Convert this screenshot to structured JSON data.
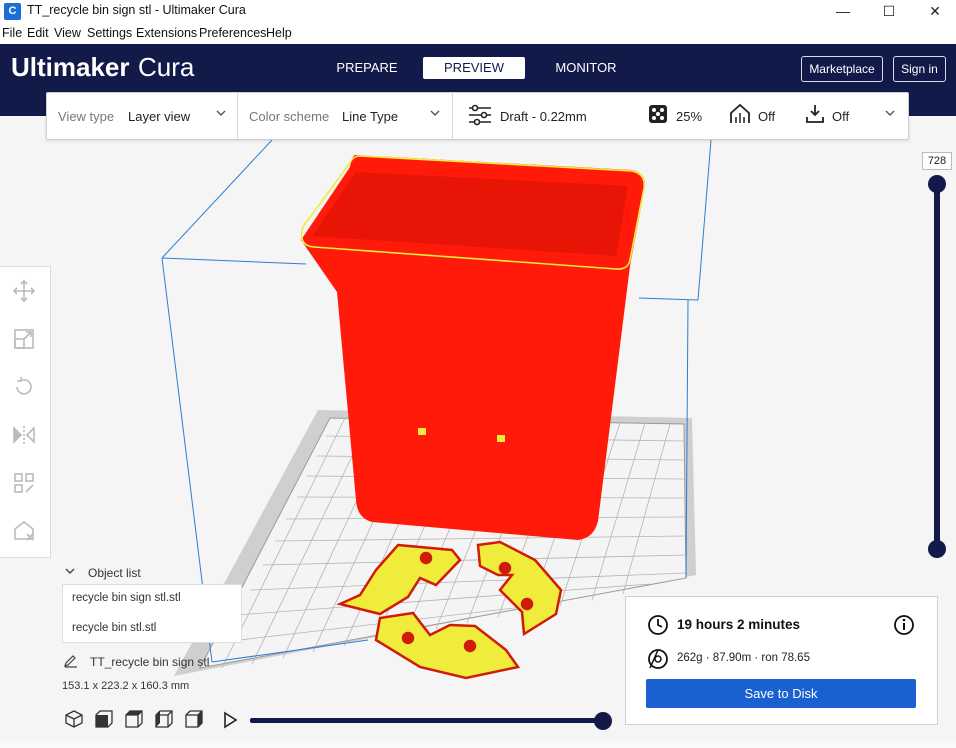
{
  "window": {
    "title": "TT_recycle bin sign stl - Ultimaker Cura",
    "app_icon_letter": "C",
    "controls": {
      "minimize": "—",
      "maximize": "☐",
      "close": "✕"
    }
  },
  "menubar": [
    "File",
    "Edit",
    "View",
    "Settings",
    "Extensions",
    "Preferences",
    "Help"
  ],
  "header": {
    "brand": "Ultimaker",
    "product": "Cura",
    "stages": [
      "PREPARE",
      "PREVIEW",
      "MONITOR"
    ],
    "active_stage": "PREVIEW",
    "marketplace_label": "Marketplace",
    "signin_label": "Sign in",
    "background_color": "#121a4a"
  },
  "view_toolbar": {
    "view_type_label": "View type",
    "view_type_value": "Layer view",
    "color_scheme_label": "Color scheme",
    "color_scheme_value": "Line Type",
    "profile": "Draft - 0.22mm",
    "infill": "25%",
    "support": "Off",
    "adhesion": "Off",
    "icons": [
      "settings-sliders-icon",
      "infill-icon",
      "support-icon",
      "adhesion-icon",
      "chevron-down-icon"
    ]
  },
  "left_tools": [
    "move-icon",
    "scale-icon",
    "rotate-icon",
    "mirror-icon",
    "per-model-settings-icon",
    "support-blocker-icon"
  ],
  "layer_slider": {
    "current_layer": "728"
  },
  "object_list": {
    "title": "Object list",
    "items": [
      "recycle bin sign stl.stl",
      "recycle bin stl.stl"
    ],
    "project_name": "TT_recycle bin sign stl",
    "dimensions": "153.1 x 223.2 x 160.3 mm"
  },
  "camera_views": [
    "3d-view-icon",
    "front-view-icon",
    "top-view-icon",
    "left-view-icon",
    "right-view-icon"
  ],
  "simulation": {
    "progress": 1.0
  },
  "print_info": {
    "time": "19 hours 2 minutes",
    "material": "262g · 87.90m · ron 78.65",
    "save_label": "Save to Disk",
    "accent_color": "#1960d0"
  },
  "model_colors": {
    "wall": "#ff1a0a",
    "skin": "#f0ec3c",
    "build_volume": "#2a7fd0"
  }
}
